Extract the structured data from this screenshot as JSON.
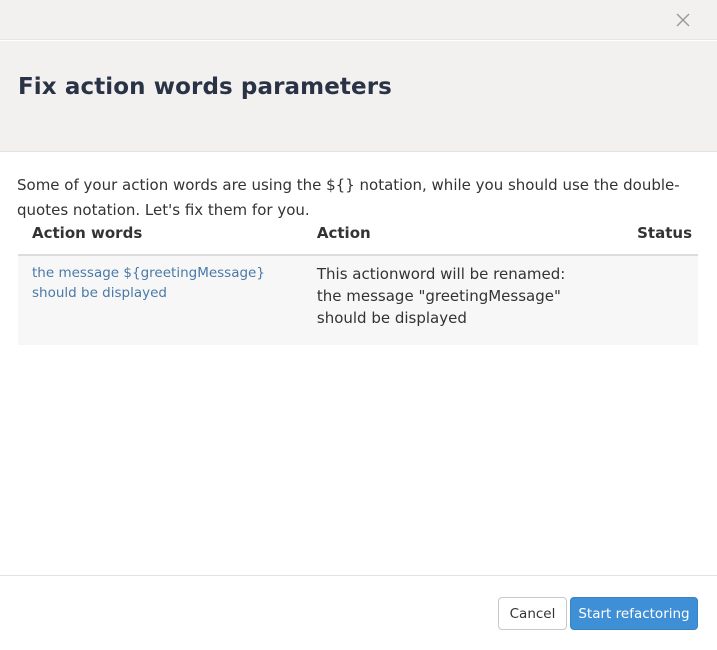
{
  "dialog": {
    "close_icon": "close-icon",
    "title": "Fix action words parameters",
    "intro": "Some of your action words are using the ${} notation, while you should use the double-quotes notation. Let's fix them for you.",
    "table": {
      "headers": {
        "action_words": "Action words",
        "action": "Action",
        "status": "Status"
      },
      "rows": [
        {
          "action_word": "the message ${greetingMessage} should be displayed",
          "action_line1": "This actionword will be renamed:",
          "action_line2": "the message \"greetingMessage\" should be displayed",
          "status": ""
        }
      ]
    },
    "footer": {
      "cancel_label": "Cancel",
      "start_label": "Start refactoring"
    },
    "colors": {
      "header_bg": "#f2f1f0",
      "title": "#2a3245",
      "link": "#4a79a8",
      "primary_button": "#3e8fd6"
    }
  }
}
